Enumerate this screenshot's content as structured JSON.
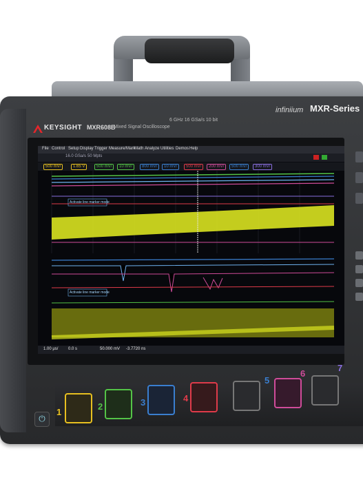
{
  "device": {
    "brand": "KEYSIGHT",
    "model": "MXR608B",
    "model_description": "Mixed Signal Oscilloscope",
    "specs": "6 GHz  16 GSa/s  10 bit",
    "family_script": "infiniium",
    "series": "MXR-Series",
    "power_icon": "power-icon"
  },
  "screen": {
    "menu": [
      "File",
      "Control",
      "Setup",
      "Display",
      "Trigger",
      "Measure/Mark",
      "Math",
      "Analyze",
      "Utilities",
      "Demos",
      "Help"
    ],
    "toolbar": [
      "16.0 GSa/s",
      "50 Mpts"
    ],
    "channel_readouts": [
      "500 mV/",
      "1.65 V",
      "500 mV/",
      "10 mV/",
      "800 mV/",
      "10 mV/",
      "500 mV/",
      "200 mV/",
      "500 mV/",
      "300 mV/"
    ],
    "annotation_top": "Activate line marker mode",
    "annotation_bottom": "Activate line marker mode",
    "bottom_readouts": [
      "1.00 μs/",
      "0.0 s",
      "50.000 mV",
      "-3.7720 ns"
    ]
  },
  "front_panel": {
    "port_labels": [
      "1",
      "2",
      "3",
      "4",
      "5",
      "6",
      "7"
    ],
    "colors": {
      "ch1": "#e8c020",
      "ch2": "#54c447",
      "ch3": "#3a7fd0",
      "ch4": "#e03b4a",
      "ch6": "#d04c9a",
      "ch7": "#8a6fe0",
      "trace_yellow": "#d9e320"
    }
  }
}
